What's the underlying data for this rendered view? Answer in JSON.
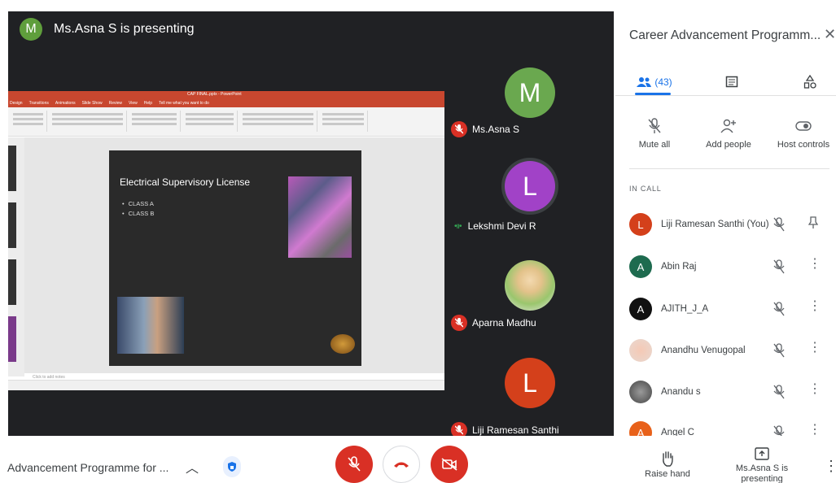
{
  "stage": {
    "presenter_initial": "M",
    "presenter_label": "Ms.Asna S is presenting"
  },
  "screen": {
    "ppt_window_title": "CAP FINAL.pptx - PowerPoint",
    "ppt_tabs": [
      "Design",
      "Transitions",
      "Animations",
      "Slide Show",
      "Review",
      "View",
      "Help",
      "Tell me what you want to do"
    ],
    "slide_title": "Electrical Supervisory License",
    "bullets": [
      "CLASS A",
      "CLASS B"
    ],
    "notes_placeholder": "Click to add notes"
  },
  "tiles": [
    {
      "initial": "M",
      "name": "Ms.Asna S",
      "color": "#6aa84f",
      "muted": true
    },
    {
      "initial": "L",
      "name": "Lekshmi Devi R",
      "color": "#a142c7",
      "muted": false
    },
    {
      "initial": "",
      "name": "Aparna Madhu",
      "color": "#f1f1f1",
      "muted": true
    },
    {
      "initial": "L",
      "name": "Liji Ramesan Santhi",
      "color": "#d4401b",
      "muted": true
    }
  ],
  "bottom": {
    "meeting_title": "Advancement Programme for ...",
    "raise_hand": "Raise hand",
    "presenting": "Ms.Asna S is presenting"
  },
  "panel": {
    "title": "Career Advancement Programm...",
    "people_count": "(43)",
    "actions": {
      "mute_all": "Mute all",
      "add_people": "Add people",
      "host_controls": "Host controls"
    },
    "in_call": "IN CALL",
    "participants": [
      {
        "initial": "L",
        "name": "Liji Ramesan Santhi (You)",
        "color": "#d4401b"
      },
      {
        "initial": "A",
        "name": "Abin Raj",
        "color": "#1e6b4f"
      },
      {
        "initial": "A",
        "name": "AJITH_J_A",
        "color": "#111111"
      },
      {
        "initial": "",
        "name": "Anandhu Venugopal",
        "color": "#e8d8d0"
      },
      {
        "initial": "",
        "name": "Anandu s",
        "color": "#6b6b6b"
      },
      {
        "initial": "A",
        "name": "Angel C",
        "color": "#e8611a"
      }
    ]
  },
  "colors": {
    "accent": "#1a73e8",
    "danger": "#d93025",
    "stage_bg": "#202124"
  }
}
